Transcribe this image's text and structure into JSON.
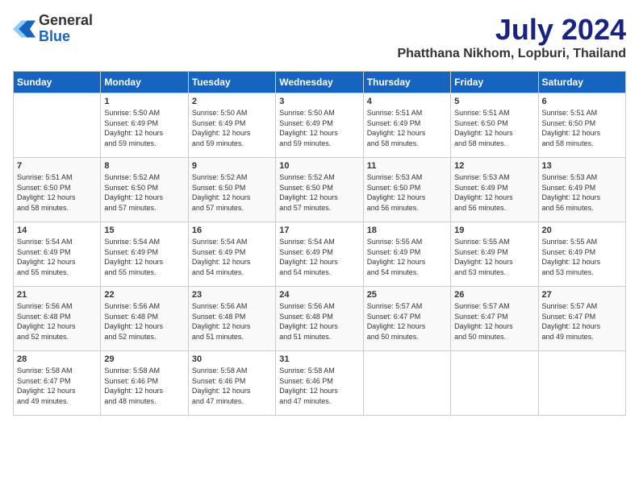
{
  "header": {
    "logo_general": "General",
    "logo_blue": "Blue",
    "month_year": "July 2024",
    "location": "Phatthana Nikhom, Lopburi, Thailand"
  },
  "days_of_week": [
    "Sunday",
    "Monday",
    "Tuesday",
    "Wednesday",
    "Thursday",
    "Friday",
    "Saturday"
  ],
  "weeks": [
    [
      {
        "day": "",
        "info": ""
      },
      {
        "day": "1",
        "info": "Sunrise: 5:50 AM\nSunset: 6:49 PM\nDaylight: 12 hours\nand 59 minutes."
      },
      {
        "day": "2",
        "info": "Sunrise: 5:50 AM\nSunset: 6:49 PM\nDaylight: 12 hours\nand 59 minutes."
      },
      {
        "day": "3",
        "info": "Sunrise: 5:50 AM\nSunset: 6:49 PM\nDaylight: 12 hours\nand 59 minutes."
      },
      {
        "day": "4",
        "info": "Sunrise: 5:51 AM\nSunset: 6:49 PM\nDaylight: 12 hours\nand 58 minutes."
      },
      {
        "day": "5",
        "info": "Sunrise: 5:51 AM\nSunset: 6:50 PM\nDaylight: 12 hours\nand 58 minutes."
      },
      {
        "day": "6",
        "info": "Sunrise: 5:51 AM\nSunset: 6:50 PM\nDaylight: 12 hours\nand 58 minutes."
      }
    ],
    [
      {
        "day": "7",
        "info": "Sunrise: 5:51 AM\nSunset: 6:50 PM\nDaylight: 12 hours\nand 58 minutes."
      },
      {
        "day": "8",
        "info": "Sunrise: 5:52 AM\nSunset: 6:50 PM\nDaylight: 12 hours\nand 57 minutes."
      },
      {
        "day": "9",
        "info": "Sunrise: 5:52 AM\nSunset: 6:50 PM\nDaylight: 12 hours\nand 57 minutes."
      },
      {
        "day": "10",
        "info": "Sunrise: 5:52 AM\nSunset: 6:50 PM\nDaylight: 12 hours\nand 57 minutes."
      },
      {
        "day": "11",
        "info": "Sunrise: 5:53 AM\nSunset: 6:50 PM\nDaylight: 12 hours\nand 56 minutes."
      },
      {
        "day": "12",
        "info": "Sunrise: 5:53 AM\nSunset: 6:49 PM\nDaylight: 12 hours\nand 56 minutes."
      },
      {
        "day": "13",
        "info": "Sunrise: 5:53 AM\nSunset: 6:49 PM\nDaylight: 12 hours\nand 56 minutes."
      }
    ],
    [
      {
        "day": "14",
        "info": "Sunrise: 5:54 AM\nSunset: 6:49 PM\nDaylight: 12 hours\nand 55 minutes."
      },
      {
        "day": "15",
        "info": "Sunrise: 5:54 AM\nSunset: 6:49 PM\nDaylight: 12 hours\nand 55 minutes."
      },
      {
        "day": "16",
        "info": "Sunrise: 5:54 AM\nSunset: 6:49 PM\nDaylight: 12 hours\nand 54 minutes."
      },
      {
        "day": "17",
        "info": "Sunrise: 5:54 AM\nSunset: 6:49 PM\nDaylight: 12 hours\nand 54 minutes."
      },
      {
        "day": "18",
        "info": "Sunrise: 5:55 AM\nSunset: 6:49 PM\nDaylight: 12 hours\nand 54 minutes."
      },
      {
        "day": "19",
        "info": "Sunrise: 5:55 AM\nSunset: 6:49 PM\nDaylight: 12 hours\nand 53 minutes."
      },
      {
        "day": "20",
        "info": "Sunrise: 5:55 AM\nSunset: 6:49 PM\nDaylight: 12 hours\nand 53 minutes."
      }
    ],
    [
      {
        "day": "21",
        "info": "Sunrise: 5:56 AM\nSunset: 6:48 PM\nDaylight: 12 hours\nand 52 minutes."
      },
      {
        "day": "22",
        "info": "Sunrise: 5:56 AM\nSunset: 6:48 PM\nDaylight: 12 hours\nand 52 minutes."
      },
      {
        "day": "23",
        "info": "Sunrise: 5:56 AM\nSunset: 6:48 PM\nDaylight: 12 hours\nand 51 minutes."
      },
      {
        "day": "24",
        "info": "Sunrise: 5:56 AM\nSunset: 6:48 PM\nDaylight: 12 hours\nand 51 minutes."
      },
      {
        "day": "25",
        "info": "Sunrise: 5:57 AM\nSunset: 6:47 PM\nDaylight: 12 hours\nand 50 minutes."
      },
      {
        "day": "26",
        "info": "Sunrise: 5:57 AM\nSunset: 6:47 PM\nDaylight: 12 hours\nand 50 minutes."
      },
      {
        "day": "27",
        "info": "Sunrise: 5:57 AM\nSunset: 6:47 PM\nDaylight: 12 hours\nand 49 minutes."
      }
    ],
    [
      {
        "day": "28",
        "info": "Sunrise: 5:58 AM\nSunset: 6:47 PM\nDaylight: 12 hours\nand 49 minutes."
      },
      {
        "day": "29",
        "info": "Sunrise: 5:58 AM\nSunset: 6:46 PM\nDaylight: 12 hours\nand 48 minutes."
      },
      {
        "day": "30",
        "info": "Sunrise: 5:58 AM\nSunset: 6:46 PM\nDaylight: 12 hours\nand 47 minutes."
      },
      {
        "day": "31",
        "info": "Sunrise: 5:58 AM\nSunset: 6:46 PM\nDaylight: 12 hours\nand 47 minutes."
      },
      {
        "day": "",
        "info": ""
      },
      {
        "day": "",
        "info": ""
      },
      {
        "day": "",
        "info": ""
      }
    ]
  ]
}
